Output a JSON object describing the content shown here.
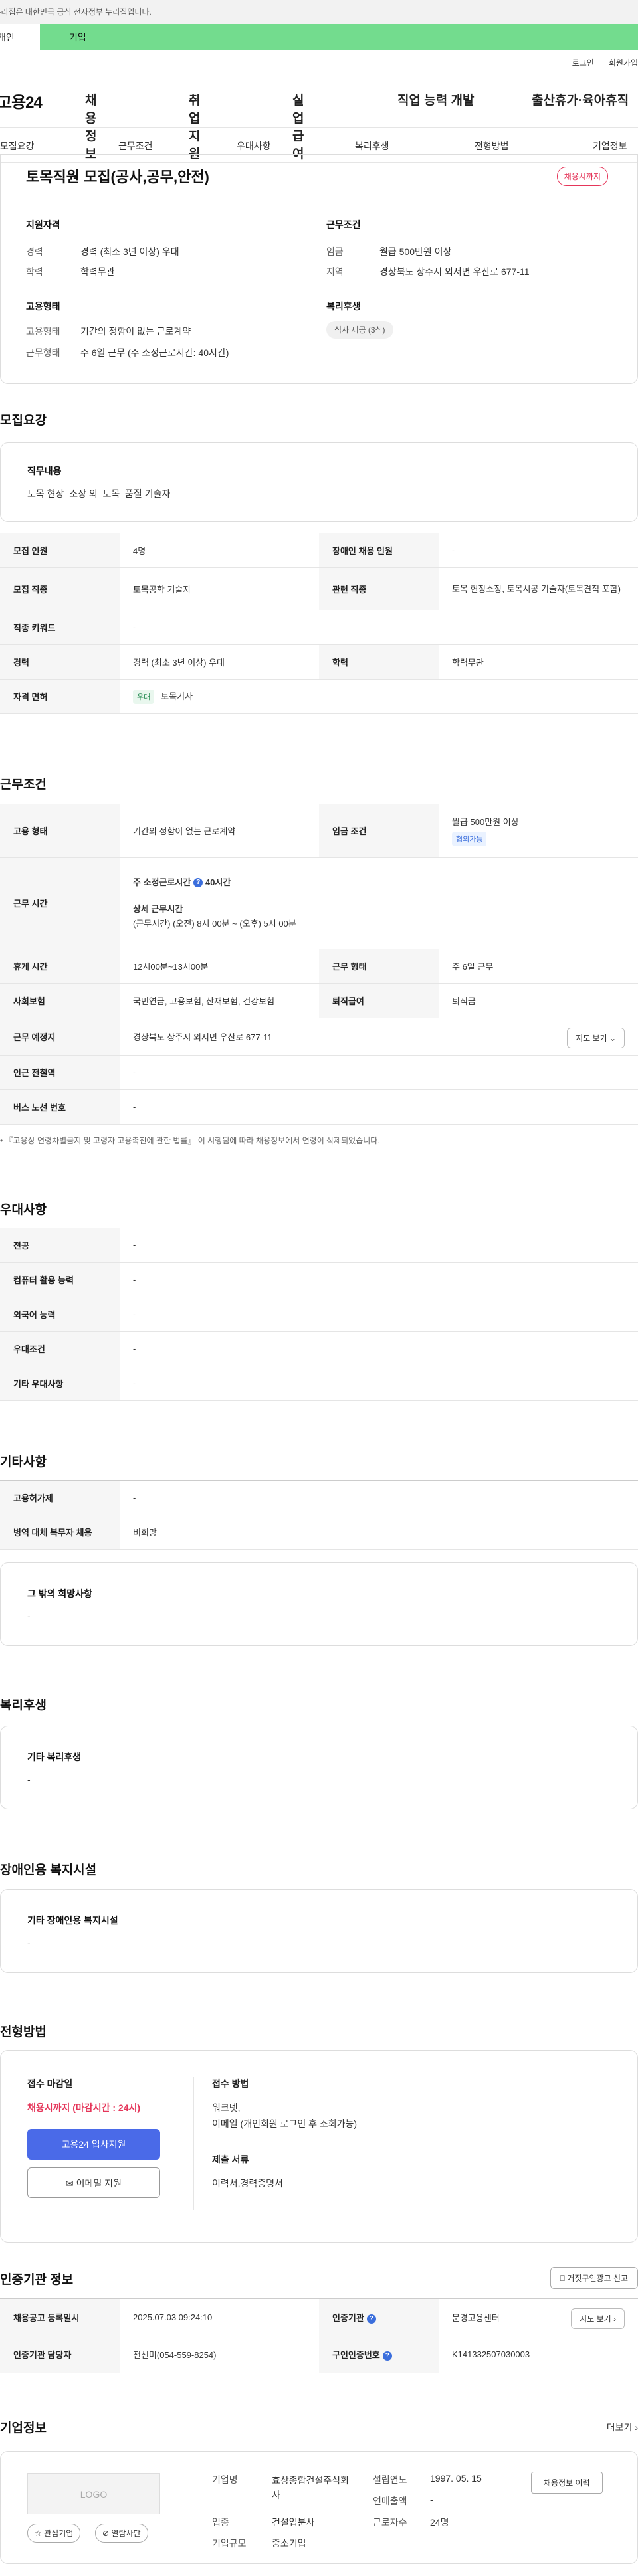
{
  "gov_banner": "이 누리집은 대한민국 공식 전자정부 누리집입니다.",
  "tabs": {
    "personal": "개인",
    "company": "기업"
  },
  "header": {
    "login": "로그인",
    "signup": "회원가입",
    "logo": "고용24",
    "gnb": [
      "채용정보",
      "취업지원",
      "실업급여",
      "직업 능력 개발",
      "출산휴가·육아휴직"
    ]
  },
  "subnav": [
    "모집요강",
    "근무조건",
    "우대사항",
    "복리후생",
    "전형방법",
    "기업정보"
  ],
  "summary": {
    "title": "토목직원 모집(공사,공무,안전)",
    "deadline_badge": "채용시까지",
    "qualification": {
      "title": "지원자격",
      "career_label": "경력",
      "career_value": "경력 (최소 3년 이상) 우대",
      "edu_label": "학력",
      "edu_value": "학력무관"
    },
    "conditions": {
      "title": "근무조건",
      "wage_label": "임금",
      "wage_value": "월급 500만원 이상",
      "region_label": "지역",
      "region_value": "경상북도 상주시 외서면 우산로 677-11"
    },
    "employment": {
      "title": "고용형태",
      "type_label": "고용형태",
      "type_value": "기간의 정함이 없는 근로계약",
      "hours_label": "근무형태",
      "hours_value": "주 6일 근무 (주 소정근로시간: 40시간)"
    },
    "welfare": {
      "title": "복리후생",
      "chip": "식사 제공 (3식)"
    }
  },
  "recruit": {
    "section_title": "모집요강",
    "duty_title": "직무내용",
    "duty_value": "토목 현장  소장 외  토목  품질 기술자",
    "rows": {
      "headcount_label": "모집 인원",
      "headcount_value": "4명",
      "disabled_label": "장애인 채용 인원",
      "disabled_value": "-",
      "job_label": "모집 직종",
      "job_value": "토목공학 기술자",
      "related_label": "관련 직종",
      "related_value": "토목 현장소장, 토목시공 기술자(토목견적 포함)",
      "keyword_label": "직종 키워드",
      "keyword_value": "-",
      "career_label": "경력",
      "career_value": "경력 (최소 3년 이상) 우대",
      "edu_label": "학력",
      "edu_value": "학력무관",
      "license_label": "자격 면허",
      "license_chip": "우대",
      "license_value": "토목기사"
    }
  },
  "work": {
    "section_title": "근무조건",
    "type_label": "고용 형태",
    "type_value": "기간의 정함이 없는 근로계약",
    "wage_label": "임금 조건",
    "wage_value": "월급 500만원 이상",
    "wage_chip": "협의가능",
    "hours_label": "근무 시간",
    "hours_weekly_label": "주 소정근로시간",
    "hours_weekly_value": "40시간",
    "hours_detail_label": "상세 근무시간",
    "hours_detail_value": "(근무시간) (오전) 8시 00분 ~ (오후) 5시 00분",
    "break_label": "휴게 시간",
    "break_value": "12시00분~13시00분",
    "form_label": "근무 형태",
    "form_value": "주 6일 근무",
    "insurance_label": "사회보험",
    "insurance_value": "국민연금, 고용보험, 산재보험, 건강보험",
    "severance_label": "퇴직급여",
    "severance_value": "퇴직금",
    "place_label": "근무 예정지",
    "place_value": "경상북도 상주시 외서면 우산로 677-11",
    "map_btn": "지도 보기",
    "subway_label": "인근 전철역",
    "subway_value": "-",
    "bus_label": "버스 노선 번호",
    "bus_value": "-",
    "note": "• 『고용상 연령차별금지 및 고령자 고용촉진에 관한 법률』 이 시행됨에 따라 채용정보에서 연령이 삭제되었습니다."
  },
  "preference": {
    "section_title": "우대사항",
    "rows": [
      {
        "label": "전공",
        "value": "-"
      },
      {
        "label": "컴퓨터 활용 능력",
        "value": "-"
      },
      {
        "label": "외국어 능력",
        "value": "-"
      },
      {
        "label": "우대조건",
        "value": "-"
      },
      {
        "label": "기타 우대사항",
        "value": "-"
      }
    ]
  },
  "etc": {
    "section_title": "기타사항",
    "rows": [
      {
        "label": "고용허가제",
        "value": "-"
      },
      {
        "label": "병역 대체 복무자 채용",
        "value": "비희망"
      }
    ],
    "other_title": "그 밖의 희망사항",
    "other_value": "-"
  },
  "welfare": {
    "section_title": "복리후생",
    "box_title": "기타 복리후생",
    "box_value": "-"
  },
  "disabled_facility": {
    "section_title": "장애인용 복지시설",
    "box_title": "기타 장애인용 복지시설",
    "box_value": "-"
  },
  "selection": {
    "section_title": "전형방법",
    "deadline_title": "접수 마감일",
    "deadline_value": "채용시까지 (마감시간 : 24시)",
    "apply_btn": "고용24 입사지원",
    "email_btn": "이메일 지원",
    "method_title": "접수 방법",
    "method_value_1": "워크넷,",
    "method_value_2": "이메일 (개인회원 로그인 후 조회가능)",
    "docs_title": "제출 서류",
    "docs_value": "이력서,경력증명서"
  },
  "certification": {
    "section_title": "인증기관 정보",
    "report_btn": "거짓구인광고 신고",
    "reg_label": "채용공고 등록일시",
    "reg_value": "2025.07.03 09:24:10",
    "org_label": "인증기관",
    "org_value": "문경고용센터",
    "map_btn": "지도 보기",
    "manager_label": "인증기관 담당자",
    "manager_value": "전선미(054-559-8254)",
    "number_label": "구인인증번호",
    "number_value": "K141332507030003"
  },
  "company": {
    "section_title": "기업정보",
    "more": "더보기",
    "logo_placeholder": "LOGO",
    "interest_btn": "관심기업",
    "block_btn": "열람차단",
    "name_label": "기업명",
    "name_value": "효상종합건설주식회사",
    "industry_label": "업종",
    "industry_value": "건설업분사",
    "scale_label": "기업규모",
    "scale_value": "중소기업",
    "founded_label": "설립연도",
    "founded_value": "1997. 05. 15",
    "revenue_label": "연매출액",
    "revenue_value": "-",
    "employees_label": "근로자수",
    "employees_value": "24명",
    "history_btn": "채용정보 이력"
  }
}
